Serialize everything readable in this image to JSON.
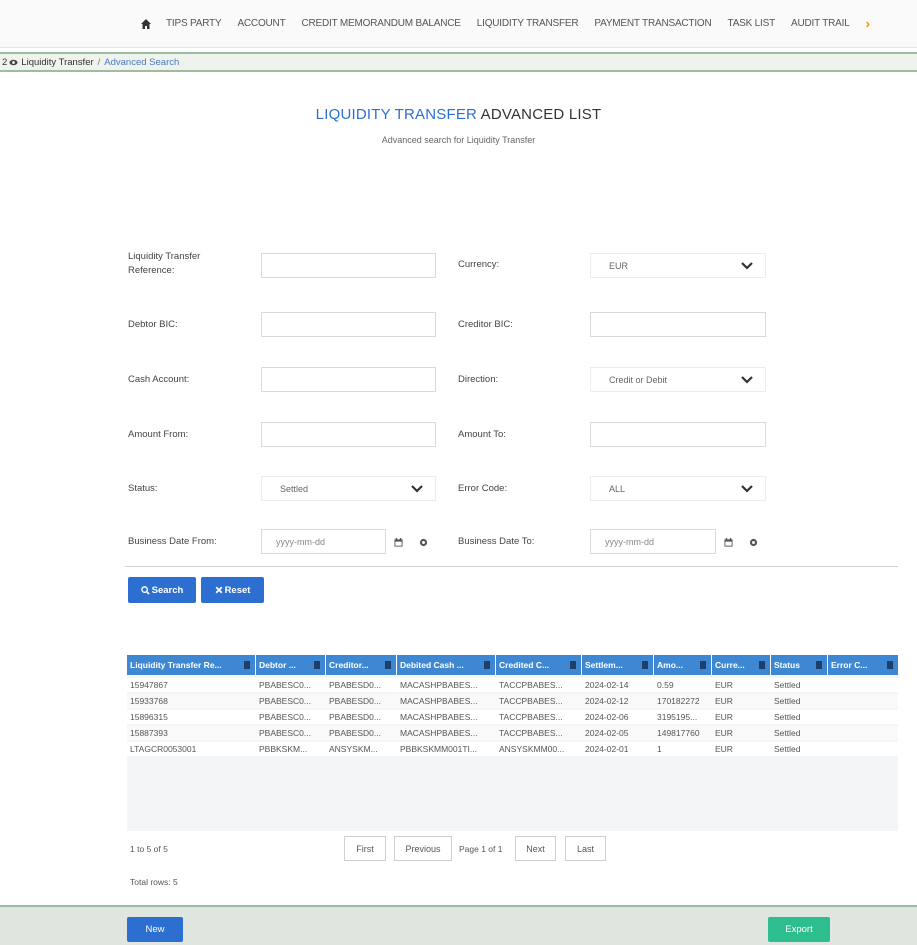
{
  "nav": {
    "items": [
      "TIPS PARTY",
      "ACCOUNT",
      "CREDIT MEMORANDUM BALANCE",
      "LIQUIDITY TRANSFER",
      "PAYMENT TRANSACTION",
      "TASK LIST",
      "AUDIT TRAIL"
    ],
    "more": "›"
  },
  "breadcrumb": {
    "prefix": "2",
    "parent": "Liquidity Transfer",
    "separator": "/",
    "current": "Advanced Search"
  },
  "page": {
    "title_accent": "LIQUIDITY TRANSFER",
    "title_rest": " ADVANCED LIST",
    "subtitle": "Advanced search for Liquidity Transfer"
  },
  "form": {
    "ref_label_line1": "Liquidity Transfer",
    "ref_label_line2": "Reference:",
    "currency_label": "Currency:",
    "currency_value": "EUR",
    "debtor_label": "Debtor BIC:",
    "creditor_label": "Creditor BIC:",
    "cash_label": "Cash Account:",
    "direction_label": "Direction:",
    "direction_value": "Credit or Debit",
    "amount_from_label": "Amount From:",
    "amount_to_label": "Amount To:",
    "status_label": "Status:",
    "status_value": "Settled",
    "error_label": "Error Code:",
    "error_value": "ALL",
    "bdate_from_label": "Business Date From:",
    "bdate_to_label": "Business Date To:",
    "date_placeholder": "yyyy-mm-dd"
  },
  "buttons": {
    "search": "Search",
    "reset": "Reset",
    "new": "New",
    "export": "Export"
  },
  "grid": {
    "headers": [
      "Liquidity Transfer Re...",
      "Debtor ...",
      "Creditor...",
      "Debited Cash ...",
      "Credited C...",
      "Settlem...",
      "Amo...",
      "Curre...",
      "Status",
      "Error C..."
    ],
    "rows": [
      [
        "15947867",
        "PBABESC0...",
        "PBABESD0...",
        "MACASHPBABES...",
        "TACCPBABES...",
        "2024-02-14",
        "0.59",
        "EUR",
        "Settled",
        ""
      ],
      [
        "15933768",
        "PBABESC0...",
        "PBABESD0...",
        "MACASHPBABES...",
        "TACCPBABES...",
        "2024-02-12",
        "170182272",
        "EUR",
        "Settled",
        ""
      ],
      [
        "15896315",
        "PBABESC0...",
        "PBABESD0...",
        "MACASHPBABES...",
        "TACCPBABES...",
        "2024-02-06",
        "3195195...",
        "EUR",
        "Settled",
        ""
      ],
      [
        "15887393",
        "PBABESC0...",
        "PBABESD0...",
        "MACASHPBABES...",
        "TACCPBABES...",
        "2024-02-05",
        "149817760",
        "EUR",
        "Settled",
        ""
      ],
      [
        "LTAGCR0053001",
        "PBBKSKM...",
        "ANSYSKM...",
        "PBBKSKMM001TI...",
        "ANSYSKMM00...",
        "2024-02-01",
        "1",
        "EUR",
        "Settled",
        ""
      ]
    ]
  },
  "pager": {
    "range": "1 to 5 of 5",
    "first": "First",
    "previous": "Previous",
    "page_info": "Page 1 of 1",
    "next": "Next",
    "last": "Last",
    "total": "Total rows: 5"
  },
  "colors": {
    "accent_blue": "#2d6fd1",
    "grid_header": "#3e87d3",
    "export_green": "#2ebd8f",
    "nav_more": "#f29100"
  }
}
